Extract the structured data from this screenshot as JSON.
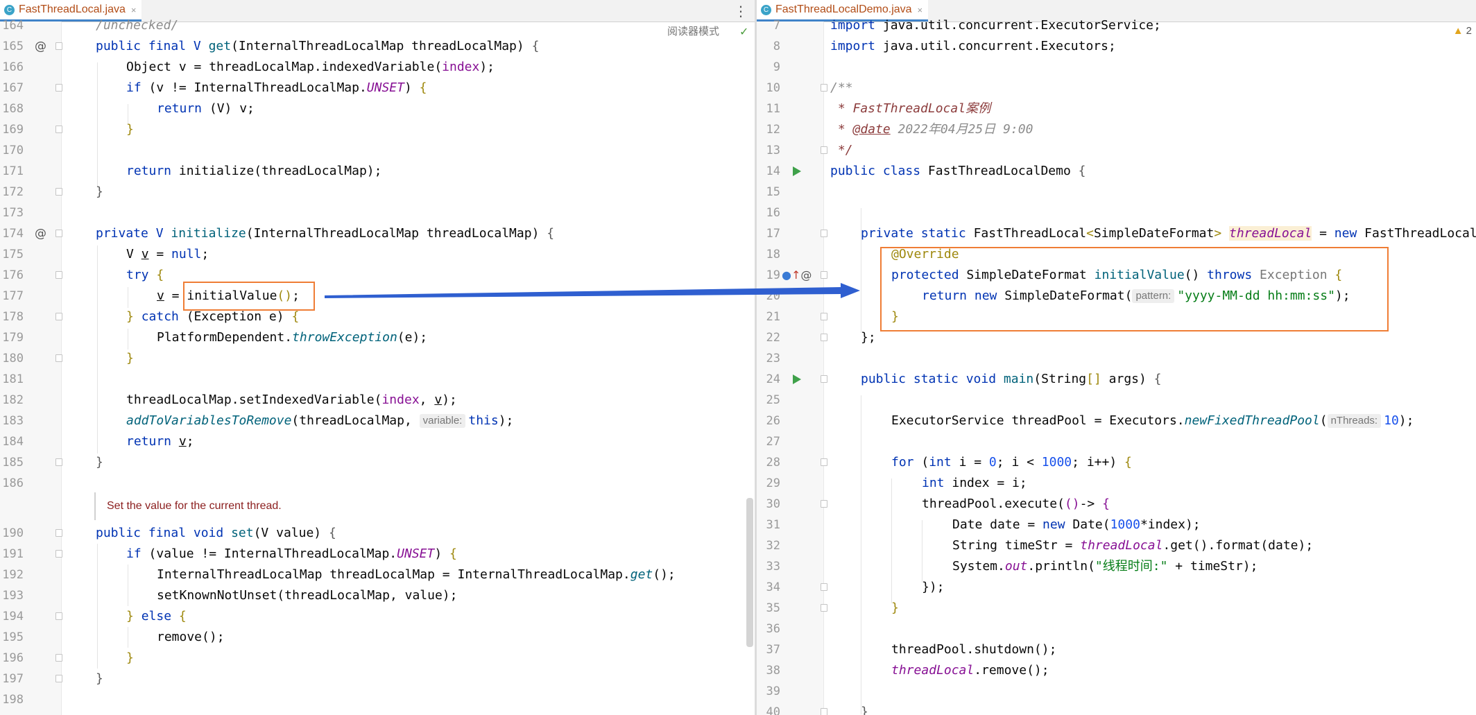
{
  "left_tab": {
    "title": "FastThreadLocal.java",
    "icon": "c-class-icon",
    "close": "×"
  },
  "right_tab": {
    "title": "FastThreadLocalDemo.java",
    "icon": "c-class-icon",
    "close": "×"
  },
  "toolbar": {
    "menu": "⋮",
    "reader_mode": "阅读器模式",
    "check": "✓",
    "warnings": "2",
    "warning_icon": "▲"
  },
  "left": {
    "lines": {
      "164": "164",
      "165": "165",
      "166": "166",
      "167": "167",
      "168": "168",
      "169": "169",
      "170": "170",
      "171": "171",
      "172": "172",
      "173": "173",
      "174": "174",
      "175": "175",
      "176": "176",
      "177": "177",
      "178": "178",
      "179": "179",
      "180": "180",
      "181": "181",
      "182": "182",
      "183": "183",
      "184": "184",
      "185": "185",
      "186": "186",
      "190": "190",
      "191": "191",
      "192": "192",
      "193": "193",
      "194": "194",
      "195": "195",
      "196": "196",
      "197": "197",
      "198": "198"
    },
    "code": {
      "c164": "/unchecked/",
      "c165_kw": "public final ",
      "c165_t": "V ",
      "c165_m": "get",
      "c165_p": "(InternalThreadLocalMap threadLocalMap) ",
      "c165_b": "{",
      "c166_a": "Object v = threadLocalMap.indexedVariable(",
      "c166_b": "index",
      "c166_c": ");",
      "c167_kw": "if ",
      "c167_a": "(v != InternalThreadLocalMap.",
      "c167_b": "UNSET",
      "c167_c": ") ",
      "c167_d": "{",
      "c168_kw": "return ",
      "c168_a": "(V) v;",
      "c169": "}",
      "c171_kw": "return ",
      "c171_a": "initialize(threadLocalMap);",
      "c172": "}",
      "c174_kw": "private ",
      "c174_t": "V ",
      "c174_m": "initialize",
      "c174_p": "(InternalThreadLocalMap threadLocalMap) ",
      "c174_b": "{",
      "c175_a": "V ",
      "c175_b": "v",
      "c175_c": " = ",
      "c175_kw": "null",
      "c175_d": ";",
      "c176_kw": "try ",
      "c176_b": "{",
      "c177_a": "v",
      "c177_b": " = ",
      "c177_c": "initialValue",
      "c177_d": "()",
      "c177_e": ";",
      "c178_a": "} ",
      "c178_kw": "catch ",
      "c178_b": "(Exception e) ",
      "c178_c": "{",
      "c179_a": "PlatformDependent.",
      "c179_b": "throwException",
      "c179_c": "(e);",
      "c180": "}",
      "c182_a": "threadLocalMap.setIndexedVariable(",
      "c182_b": "index",
      "c182_c": ", ",
      "c182_d": "v",
      "c182_e": ");",
      "c183_a": "addToVariablesToRemove",
      "c183_b": "(threadLocalMap, ",
      "c183_hint": "variable:",
      "c183_kw": "this",
      "c183_c": ");",
      "c184_kw": "return ",
      "c184_a": "v",
      "c184_b": ";",
      "c185": "}",
      "doc": "Set the value for the current thread.",
      "c190_kw": "public final void ",
      "c190_m": "set",
      "c190_p": "(V value) ",
      "c190_b": "{",
      "c191_kw": "if ",
      "c191_a": "(value != InternalThreadLocalMap.",
      "c191_b": "UNSET",
      "c191_c": ") ",
      "c191_d": "{",
      "c192_a": "InternalThreadLocalMap threadLocalMap = InternalThreadLocalMap.",
      "c192_b": "get",
      "c192_c": "();",
      "c193": "setKnownNotUnset(threadLocalMap, value);",
      "c194_a": "} ",
      "c194_kw": "else ",
      "c194_b": "{",
      "c195": "remove();",
      "c196": "}",
      "c197": "}"
    }
  },
  "right": {
    "lines": {
      "7": "7",
      "8": "8",
      "9": "9",
      "10": "10",
      "11": "11",
      "12": "12",
      "13": "13",
      "14": "14",
      "15": "15",
      "16": "16",
      "17": "17",
      "18": "18",
      "19": "19",
      "20": "20",
      "21": "21",
      "22": "22",
      "23": "23",
      "24": "24",
      "25": "25",
      "26": "26",
      "27": "27",
      "28": "28",
      "29": "29",
      "30": "30",
      "31": "31",
      "32": "32",
      "33": "33",
      "34": "34",
      "35": "35",
      "36": "36",
      "37": "37",
      "38": "38",
      "39": "39",
      "40": "40"
    },
    "code": {
      "r7_kw": "import ",
      "r7_a": "java.util.concurrent.ExecutorService;",
      "r8_kw": "import ",
      "r8_a": "java.util.concurrent.Executors;",
      "r10": "/**",
      "r11": " * FastThreadLocal案例",
      "r12_a": " * ",
      "r12_b": "@date",
      "r12_c": " 2022年04月25日 9:00",
      "r13": " */",
      "r14_kw": "public class ",
      "r14_a": "FastThreadLocalDemo ",
      "r14_b": "{",
      "r17_kw": "private static ",
      "r17_a": "FastThreadLocal",
      "r17_b": "<",
      "r17_c": "SimpleDateFormat",
      "r17_d": "> ",
      "r17_e": "threadLocal",
      "r17_f": " = ",
      "r17_kw2": "new ",
      "r17_g": "FastThreadLocal<>()",
      "r18": "@Override",
      "r19_kw": "protected ",
      "r19_a": "SimpleDateFormat ",
      "r19_m": "initialValue",
      "r19_b": "() ",
      "r19_kw2": "throws ",
      "r19_c": "Exception ",
      "r19_d": "{",
      "r20_kw": "return new ",
      "r20_a": "SimpleDateFormat",
      "r20_b": "(",
      "r20_hint": "pattern:",
      "r20_s": "\"yyyy-MM-dd hh:mm:ss\"",
      "r20_c": ");",
      "r21": "}",
      "r22": "};",
      "r24_kw": "public static void ",
      "r24_m": "main",
      "r24_a": "(String",
      "r24_b": "[] ",
      "r24_c": "args) ",
      "r24_d": "{",
      "r26_a": "ExecutorService threadPool = Executors.",
      "r26_m": "newFixedThreadPool",
      "r26_b": "(",
      "r26_hint": "nThreads:",
      "r26_n": "10",
      "r26_c": ");",
      "r28_kw": "for ",
      "r28_a": "(",
      "r28_kw2": "int ",
      "r28_b": "i = ",
      "r28_n": "0",
      "r28_c": "; i < ",
      "r28_n2": "1000",
      "r28_d": "; i++) ",
      "r28_e": "{",
      "r29_kw": "int ",
      "r29_a": "index = i;",
      "r30_a": "threadPool.execute(",
      "r30_b": "()",
      "r30_c": "-> ",
      "r30_d": "{",
      "r31_a": "Date date = ",
      "r31_kw": "new ",
      "r31_b": "Date(",
      "r31_n": "1000",
      "r31_c": "*index);",
      "r32_a": "String timeStr = ",
      "r32_b": "threadLocal",
      "r32_c": ".get().format(date);",
      "r33_a": "System.",
      "r33_b": "out",
      "r33_c": ".println(",
      "r33_s": "\"线程时间:\"",
      "r33_d": " + timeStr);",
      "r34": "});",
      "r35": "}",
      "r37": "threadPool.shutdown();",
      "r38_a": "threadLocal",
      "r38_b": ".remove();",
      "r40": "}"
    }
  },
  "colors": {
    "highlight_box": "#ef7d35",
    "arrow": "#2f5fd0",
    "keyword": "#0033b3",
    "string": "#067d17",
    "number": "#1750eb"
  }
}
